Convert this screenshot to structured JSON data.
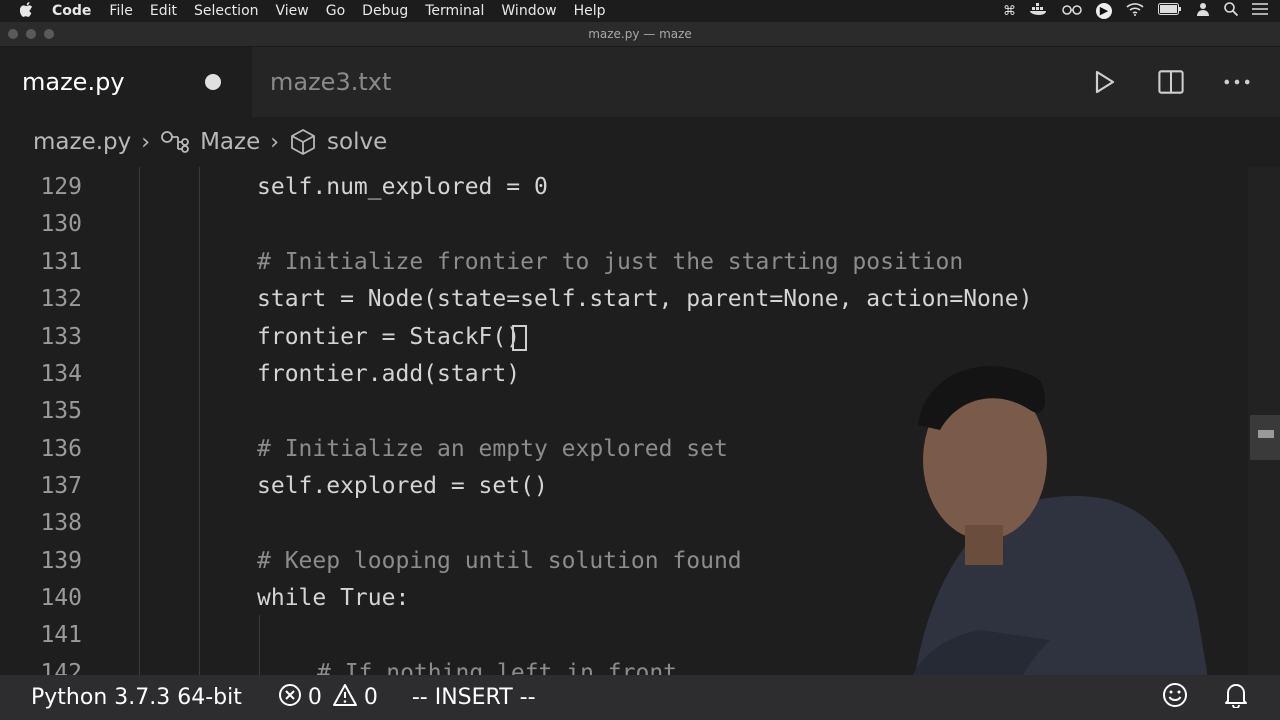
{
  "menubar": {
    "app_name": "Code",
    "items": [
      "File",
      "Edit",
      "Selection",
      "View",
      "Go",
      "Debug",
      "Terminal",
      "Window",
      "Help"
    ],
    "status_icons": [
      "command-icon",
      "docker-icon",
      "glasses-icon",
      "play-circle-icon",
      "wifi-icon",
      "battery-icon",
      "user-icon",
      "search-icon",
      "menu-icon"
    ]
  },
  "window": {
    "title": "maze.py — maze"
  },
  "tabs": [
    {
      "label": "maze.py",
      "active": true,
      "unsaved": true
    },
    {
      "label": "maze3.txt",
      "active": false,
      "unsaved": false
    }
  ],
  "breadcrumb": {
    "file": "maze.py",
    "class": "Maze",
    "method": "solve"
  },
  "editor": {
    "lines": [
      {
        "num": "129",
        "text": "self.num_explored = 0"
      },
      {
        "num": "130",
        "text": ""
      },
      {
        "num": "131",
        "text": "# Initialize frontier to just the starting position"
      },
      {
        "num": "132",
        "text": "start = Node(state=self.start, parent=None, action=None)"
      },
      {
        "num": "133",
        "text": "frontier = StackF()"
      },
      {
        "num": "134",
        "text": "frontier.add(start)"
      },
      {
        "num": "135",
        "text": ""
      },
      {
        "num": "136",
        "text": "# Initialize an empty explored set"
      },
      {
        "num": "137",
        "text": "self.explored = set()"
      },
      {
        "num": "138",
        "text": ""
      },
      {
        "num": "139",
        "text": "# Keep looping until solution found"
      },
      {
        "num": "140",
        "text": "while True:"
      },
      {
        "num": "141",
        "text": ""
      },
      {
        "num": "142",
        "text": "# If nothing left in front"
      }
    ]
  },
  "statusbar": {
    "interpreter": "Python 3.7.3 64-bit",
    "errors": "0",
    "warnings": "0",
    "mode": "-- INSERT --"
  },
  "colors": {
    "editor_bg": "#1e1e1e",
    "tabbar_bg": "#252526",
    "statusbar_bg": "#2d2d30"
  }
}
